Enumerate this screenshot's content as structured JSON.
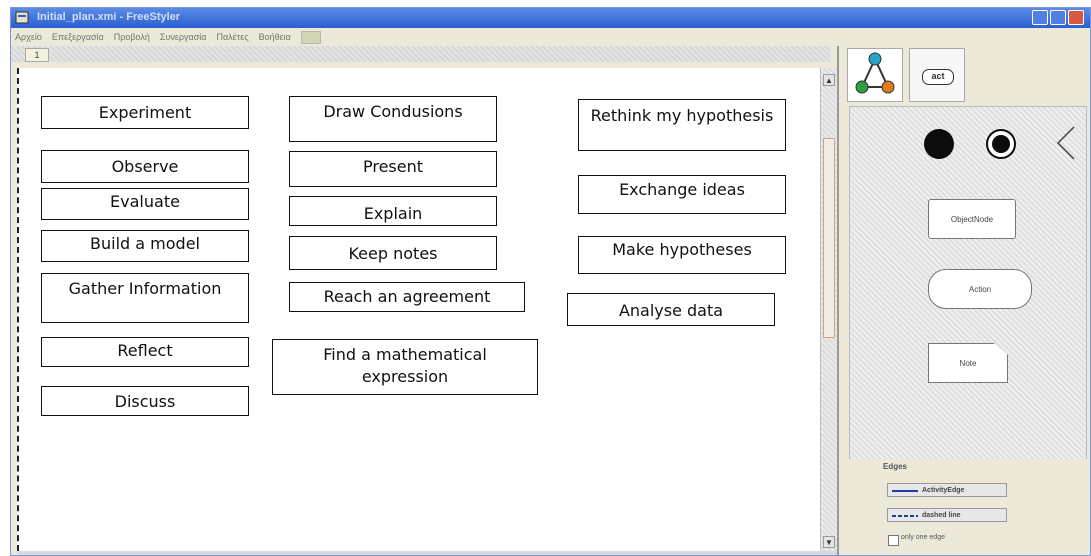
{
  "window": {
    "title": "Initial_plan.xmi - FreeStyler"
  },
  "menu": {
    "items": [
      "Αρχείο",
      "Επεξεργασία",
      "Προβολή",
      "Συνεργασία",
      "Παλέτες",
      "Βοήθεια"
    ]
  },
  "canvas": {
    "tab_label": "1",
    "nodes": {
      "experiment": "Experiment",
      "observe": "Observe",
      "evaluate": "Evaluate",
      "build_model": "Build a model",
      "gather_information": "Gather Information",
      "reflect": "Reflect",
      "discuss": "Discuss",
      "draw_conclusions": "Draw Condusions",
      "present": "Present",
      "explain": "Explain",
      "keep_notes": "Keep notes",
      "reach_agreement": "Reach an agreement",
      "find_math": "Find a mathematical expression",
      "rethink": "Rethink my hypothesis",
      "exchange_ideas": "Exchange ideas",
      "make_hypotheses": "Make hypotheses",
      "analyse_data": "Analyse data"
    }
  },
  "palette": {
    "tab_act": "act",
    "object_node": "ObjectNode",
    "action": "Action",
    "note": "Note",
    "edges_title": "Edges",
    "edge_activity": "ActivityEdge",
    "edge_dashed": "dashed line",
    "only_one_edge": "only one edge"
  },
  "colors": {
    "titlebar": "#2a5fd0",
    "node_border": "#111111",
    "canvas_bg": "#ffffff",
    "scroll_thumb": "#f1ece0"
  }
}
